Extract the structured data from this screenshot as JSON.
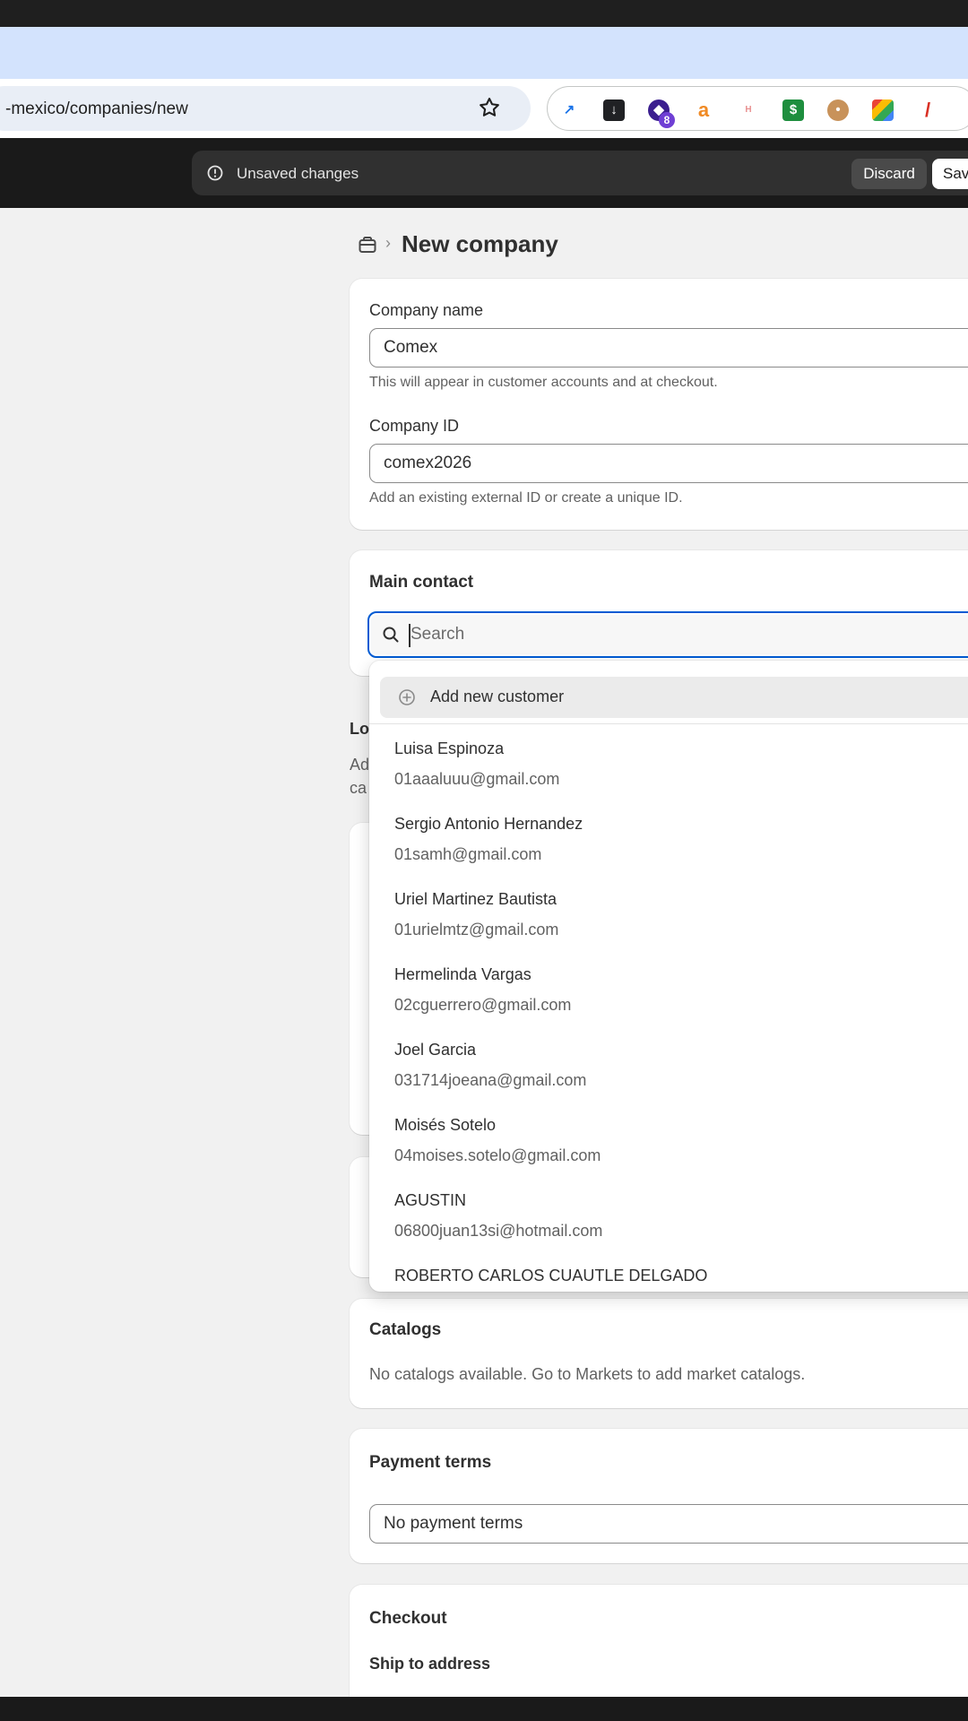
{
  "browser": {
    "url": "-mexico/companies/new",
    "extensions": [
      "rocket-ext-icon",
      "download-ext-icon",
      "tag-ext-icon",
      "amazon-ext-icon",
      "hotel-ext-icon",
      "sheets-ext-icon",
      "monkey-ext-icon",
      "photos-ext-icon",
      "pen-ext-icon"
    ],
    "extension_badge": "8"
  },
  "admin_bar": {
    "unsaved_text": "Unsaved changes",
    "discard_label": "Discard",
    "save_label": "Sav"
  },
  "page": {
    "title": "New company"
  },
  "company_card": {
    "name_label": "Company name",
    "name_value": "Comex",
    "name_help": "This will appear in customer accounts and at checkout.",
    "id_label": "Company ID",
    "id_value": "comex2026",
    "id_help": "Add an existing external ID or create a unique ID."
  },
  "main_contact": {
    "title": "Main contact",
    "search_placeholder": "Search"
  },
  "obscured_text": {
    "lo": "Lo",
    "ad": "Ad",
    "ca": "ca"
  },
  "dropdown": {
    "add_new_label": "Add new customer",
    "customers": [
      {
        "name": "Luisa Espinoza",
        "email": "01aaaluuu@gmail.com"
      },
      {
        "name": "Sergio Antonio Hernandez",
        "email": "01samh@gmail.com"
      },
      {
        "name": "Uriel Martinez Bautista",
        "email": "01urielmtz@gmail.com"
      },
      {
        "name": "Hermelinda Vargas",
        "email": "02cguerrero@gmail.com"
      },
      {
        "name": "Joel Garcia",
        "email": "031714joeana@gmail.com"
      },
      {
        "name": "Moisés Sotelo",
        "email": "04moises.sotelo@gmail.com"
      },
      {
        "name": "AGUSTIN",
        "email": "06800juan13si@hotmail.com"
      },
      {
        "name": "ROBERTO CARLOS CUAUTLE DELGADO",
        "email": ""
      }
    ]
  },
  "catalogs": {
    "title": "Catalogs",
    "text": "No catalogs available. Go to Markets to add market catalogs."
  },
  "payment_terms": {
    "title": "Payment terms",
    "value": "No payment terms"
  },
  "checkout": {
    "title": "Checkout",
    "ship_label": "Ship to address"
  },
  "colors": {
    "accent": "#005bd3",
    "admin_bar": "#1a1a1a",
    "browser_band": "#d3e3fd"
  }
}
